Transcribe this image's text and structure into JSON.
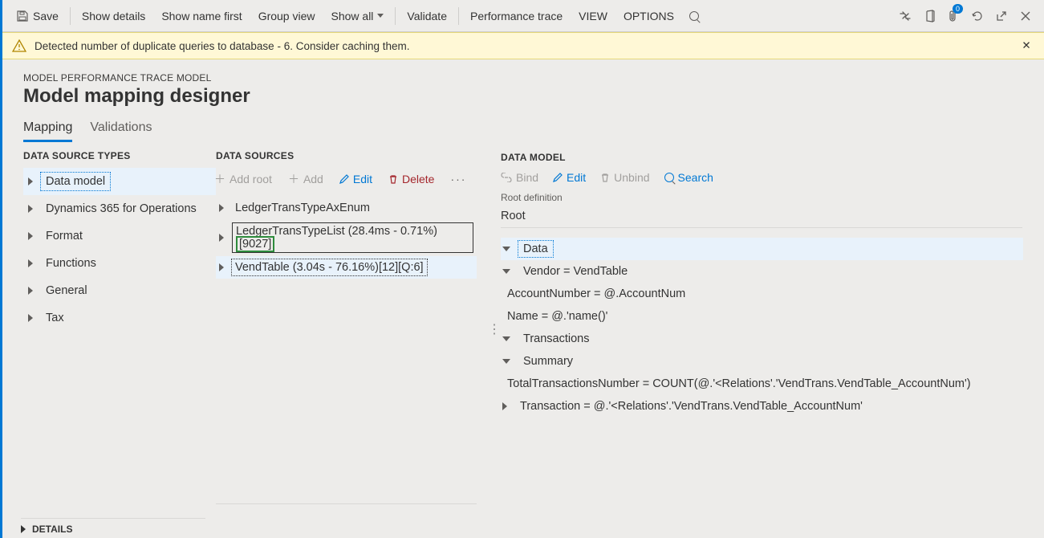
{
  "cmdbar": {
    "save": "Save",
    "show_details": "Show details",
    "show_name_first": "Show name first",
    "group_view": "Group view",
    "show_all": "Show all",
    "validate": "Validate",
    "perf_trace": "Performance trace",
    "view": "VIEW",
    "options": "OPTIONS",
    "badge": "0"
  },
  "warning": "Detected number of duplicate queries to database - 6. Consider caching them.",
  "breadcrumb": "MODEL PERFORMANCE TRACE MODEL",
  "title": "Model mapping designer",
  "tabs": {
    "mapping": "Mapping",
    "validations": "Validations"
  },
  "ds_types": {
    "header": "DATA SOURCE TYPES",
    "items": [
      "Data model",
      "Dynamics 365 for Operations",
      "Format",
      "Functions",
      "General",
      "Tax"
    ]
  },
  "ds": {
    "header": "DATA SOURCES",
    "actions": {
      "add_root": "Add root",
      "add": "Add",
      "edit": "Edit",
      "delete": "Delete"
    },
    "items": [
      {
        "label": "LedgerTransTypeAxEnum"
      },
      {
        "label_main": "LedgerTransTypeList (28.4ms - 0.71%)",
        "count_boxed": "[9027]"
      },
      {
        "label": "VendTable (3.04s - 76.16%)[12][Q:6]",
        "selected": true
      }
    ]
  },
  "dm": {
    "header": "DATA MODEL",
    "actions": {
      "bind": "Bind",
      "edit": "Edit",
      "unbind": "Unbind",
      "search": "Search"
    },
    "root_label": "Root definition",
    "root_value": "Root",
    "tree": {
      "data": "Data",
      "vendor": "Vendor = VendTable",
      "accountnum": "AccountNumber = @.AccountNum",
      "name": "Name = @.'name()'",
      "transactions": "Transactions",
      "summary": "Summary",
      "total": "TotalTransactionsNumber = COUNT(@.'<Relations'.'VendTrans.VendTable_AccountNum')",
      "transaction": "Transaction = @.'<Relations'.'VendTrans.VendTable_AccountNum'"
    }
  },
  "details": "DETAILS"
}
